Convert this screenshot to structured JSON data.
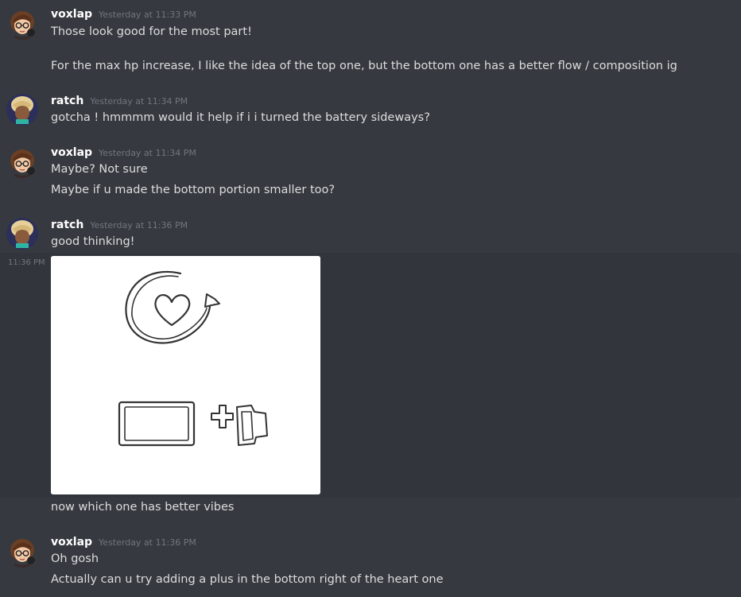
{
  "messages": [
    {
      "author": "voxlap",
      "timestamp": "Yesterday at 11:33 PM",
      "lines": [
        "Those look good for the most part!",
        "For the max hp increase, I like the idea of the top one, but the bottom one has a better flow / composition ig"
      ]
    },
    {
      "author": "ratch",
      "timestamp": "Yesterday at 11:34 PM",
      "lines": [
        "gotcha ! hmmmm would it help if i i turned the battery sideways?"
      ]
    },
    {
      "author": "voxlap",
      "timestamp": "Yesterday at 11:34 PM",
      "lines": [
        "Maybe? Not sure",
        "Maybe if u made the bottom portion smaller too?"
      ]
    },
    {
      "author": "ratch",
      "timestamp": "Yesterday at 11:36 PM",
      "lines": [
        "good thinking!"
      ],
      "attachment_side_time": "11:36 PM",
      "after_attachment": "now which one has better vibes"
    },
    {
      "author": "voxlap",
      "timestamp": "Yesterday at 11:36 PM",
      "lines": [
        "Oh gosh",
        "Actually can u try adding a plus in the bottom right of the heart one"
      ]
    }
  ],
  "colors": {
    "background": "#36393f",
    "hover_background": "#32353b",
    "author": "#ffffff",
    "text": "#dcddde",
    "timestamp": "#72767d"
  }
}
